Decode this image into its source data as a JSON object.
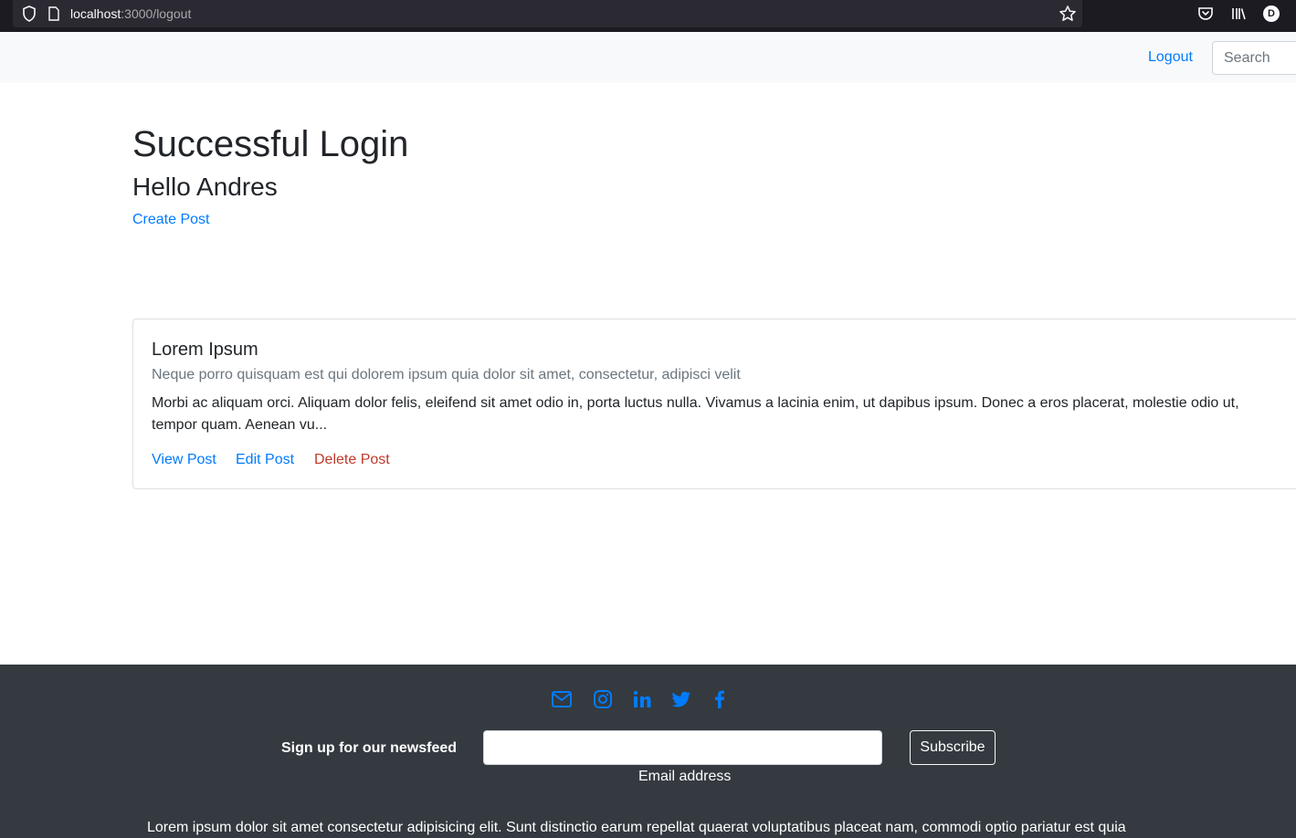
{
  "browser": {
    "url_host": "localhost",
    "url_path": ":3000/logout",
    "profile_initial": "D"
  },
  "navbar": {
    "logout_label": "Logout",
    "search_placeholder": "Search"
  },
  "main": {
    "title": "Successful Login",
    "greeting": "Hello Andres",
    "create_post_label": "Create Post"
  },
  "post": {
    "title": "Lorem Ipsum",
    "subtitle": "Neque porro quisquam est qui dolorem ipsum quia dolor sit amet, consectetur, adipisci velit",
    "excerpt": "Morbi ac aliquam orci. Aliquam dolor felis, eleifend sit amet odio in, porta luctus nulla. Vivamus a lacinia enim, ut dapibus ipsum. Donec a eros placerat, molestie odio ut, tempor quam. Aenean vu...",
    "view_label": "View Post",
    "edit_label": "Edit Post",
    "delete_label": "Delete Post"
  },
  "footer": {
    "social_icons": [
      "mail-icon",
      "instagram-icon",
      "linkedin-icon",
      "twitter-icon",
      "facebook-icon"
    ],
    "newsfeed_label": "Sign up for our newsfeed",
    "email_label": "Email address",
    "subscribe_label": "Subscribe",
    "text": "Lorem ipsum dolor sit amet consectetur adipisicing elit. Sunt distinctio earum repellat quaerat voluptatibus placeat nam, commodi optio pariatur est quia"
  },
  "colors": {
    "link": "#007bff",
    "delete": "#c0392b",
    "footer_bg": "#343a40",
    "navbar_bg": "#f8f9fa"
  }
}
